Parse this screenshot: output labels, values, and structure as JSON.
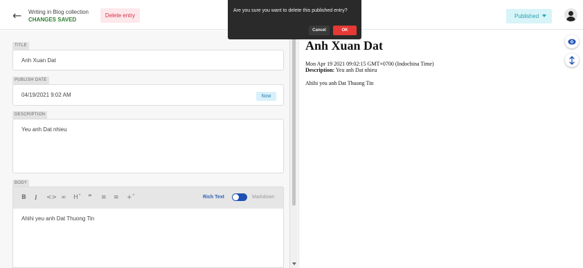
{
  "header": {
    "breadcrumb": "Writing in Blog collection",
    "save_status": "CHANGES SAVED",
    "delete_label": "Delete entry",
    "status_label": "Published"
  },
  "dialog": {
    "message": "Are you sure you want to delete this published entry?",
    "cancel_label": "Cancel",
    "ok_label": "OK"
  },
  "fields": {
    "title_label": "TITLE",
    "title_value": "Anh Xuan Dat",
    "publish_label": "PUBLISH DATE",
    "publish_value": "04/19/2021 9:02 AM",
    "now_label": "Now",
    "description_label": "DESCRIPTION",
    "description_value": "Yeu anh Dat nhieu",
    "body_label": "BODY",
    "body_value": "Ahihi yeu anh Dat Thuong Tin"
  },
  "toolbar": {
    "rich_text_label": "Rich Text",
    "markdown_label": "Markdown",
    "icons": [
      "bold-icon",
      "italic-icon",
      "code-icon",
      "link-icon",
      "heading-icon",
      "quote-icon",
      "bullet-list-icon",
      "numbered-list-icon",
      "add-component-icon"
    ]
  },
  "preview": {
    "title": "Anh Xuan Dat",
    "date": "Mon Apr 19 2021 09:02:15 GMT+0700 (Indochina Time)",
    "description_label": "Description:",
    "description_value": "Yeu anh Dat nhieu",
    "body": "Ahihi yeu anh Dat Thuong Tin"
  },
  "colors": {
    "published_bg": "#d7f4f8",
    "published_text": "#2aa0b0",
    "delete_bg": "#fde8eb",
    "delete_text": "#d62f4a",
    "ok_button": "#e53935",
    "saved_text": "#2e7d32"
  }
}
